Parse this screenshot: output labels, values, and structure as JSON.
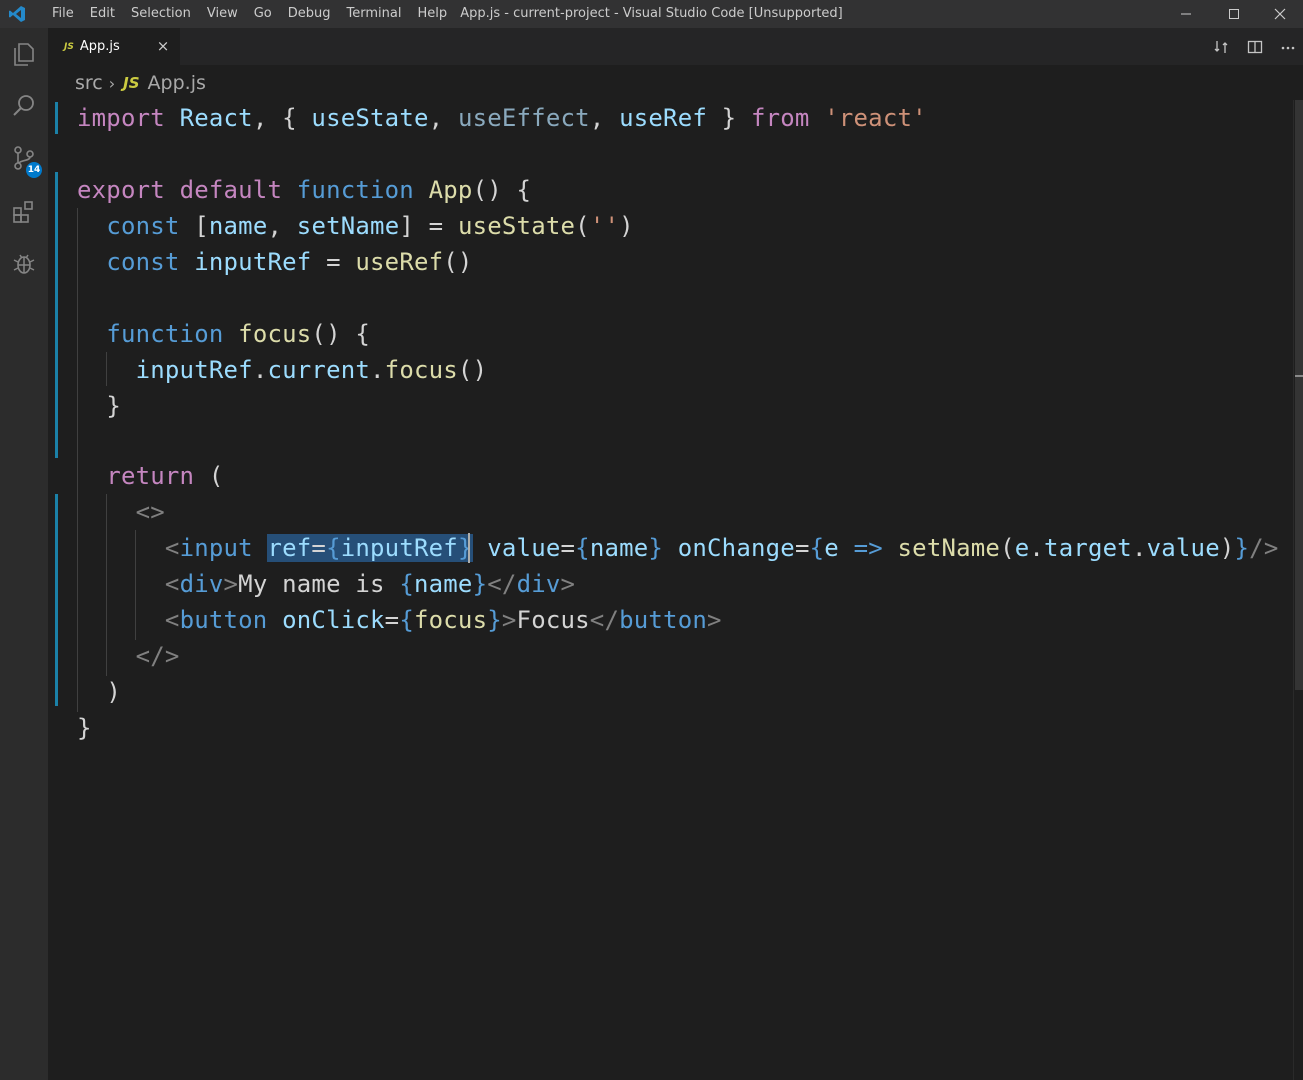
{
  "titlebar": {
    "menu": [
      "File",
      "Edit",
      "Selection",
      "View",
      "Go",
      "Debug",
      "Terminal",
      "Help"
    ],
    "title": "App.js - current-project - Visual Studio Code [Unsupported]"
  },
  "activitybar": {
    "icons": [
      "files-icon",
      "search-icon",
      "source-control-icon",
      "extensions-icon",
      "debug-icon"
    ],
    "scm_badge": "14"
  },
  "tabs": [
    {
      "icon": "JS",
      "label": "App.js",
      "close": "×"
    }
  ],
  "breadcrumb": {
    "folder": "src",
    "file_icon": "JS",
    "file": "App.js"
  },
  "code_lines": [
    "import React, { useState, useEffect, useRef } from 'react'",
    "",
    "export default function App() {",
    "  const [name, setName] = useState('')",
    "  const inputRef = useRef()",
    "",
    "  function focus() {",
    "    inputRef.current.focus()",
    "  }",
    "",
    "  return (",
    "    <>",
    "      <input ref={inputRef} value={name} onChange={e => setName(e.target.value)}/>",
    "      <div>My name is {name}</div>",
    "      <button onClick={focus}>Focus</button>",
    "    </>",
    "  )",
    "}"
  ],
  "selection": "ref={inputRef}",
  "colors": {
    "keyword": "#569cd6",
    "control": "#c586c0",
    "function": "#dcdcaa",
    "variable": "#9cdcfe",
    "string": "#ce9178",
    "accent": "#007acc",
    "selection": "#264f78"
  }
}
